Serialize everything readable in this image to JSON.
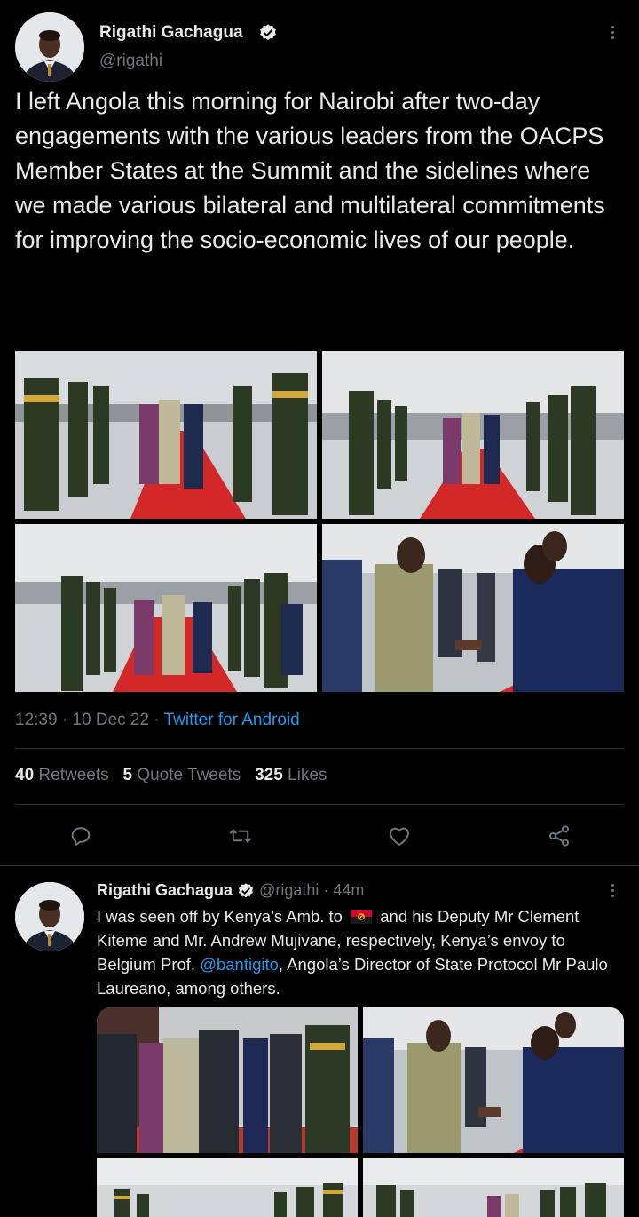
{
  "main_tweet": {
    "author_name": "Rigathi Gachagua",
    "handle": "@rigathi",
    "text": "I left Angola this morning for Nairobi after two-day engagements with the various leaders from the OACPS Member States at the Summit and the sidelines where we made various bilateral and multilateral commitments for improving the socio-economic lives of our people.",
    "time": "12:39",
    "sep": "·",
    "date": "10 Dec 22",
    "source": "Twitter for Android",
    "stats": {
      "retweets_count": "40",
      "retweets_label": "Retweets",
      "quotes_count": "5",
      "quotes_label": "Quote Tweets",
      "likes_count": "325",
      "likes_label": "Likes"
    }
  },
  "reply_tweet": {
    "author_name": "Rigathi Gachagua",
    "handle": "@rigathi",
    "sep": "·",
    "age": "44m",
    "text_part1": "I was seen off by Kenya’s Amb. to",
    "text_part2": "and his Deputy Mr Clement Kiteme and Mr. Andrew Mujivane, respectively, Kenya’s envoy to Belgium Prof.",
    "mention": "@bantigito",
    "text_part3": ", Angola’s Director of State Protocol Mr Paulo Laureano, among others."
  },
  "icons": [
    "verified-icon",
    "more-icon",
    "reply-icon",
    "retweet-icon",
    "like-icon",
    "share-icon",
    "angola-flag-icon"
  ],
  "colors": {
    "background": "#000000",
    "text": "#e7e9ea",
    "secondary": "#71767b",
    "accent": "#1d9bf0",
    "divider": "#2f3336"
  }
}
